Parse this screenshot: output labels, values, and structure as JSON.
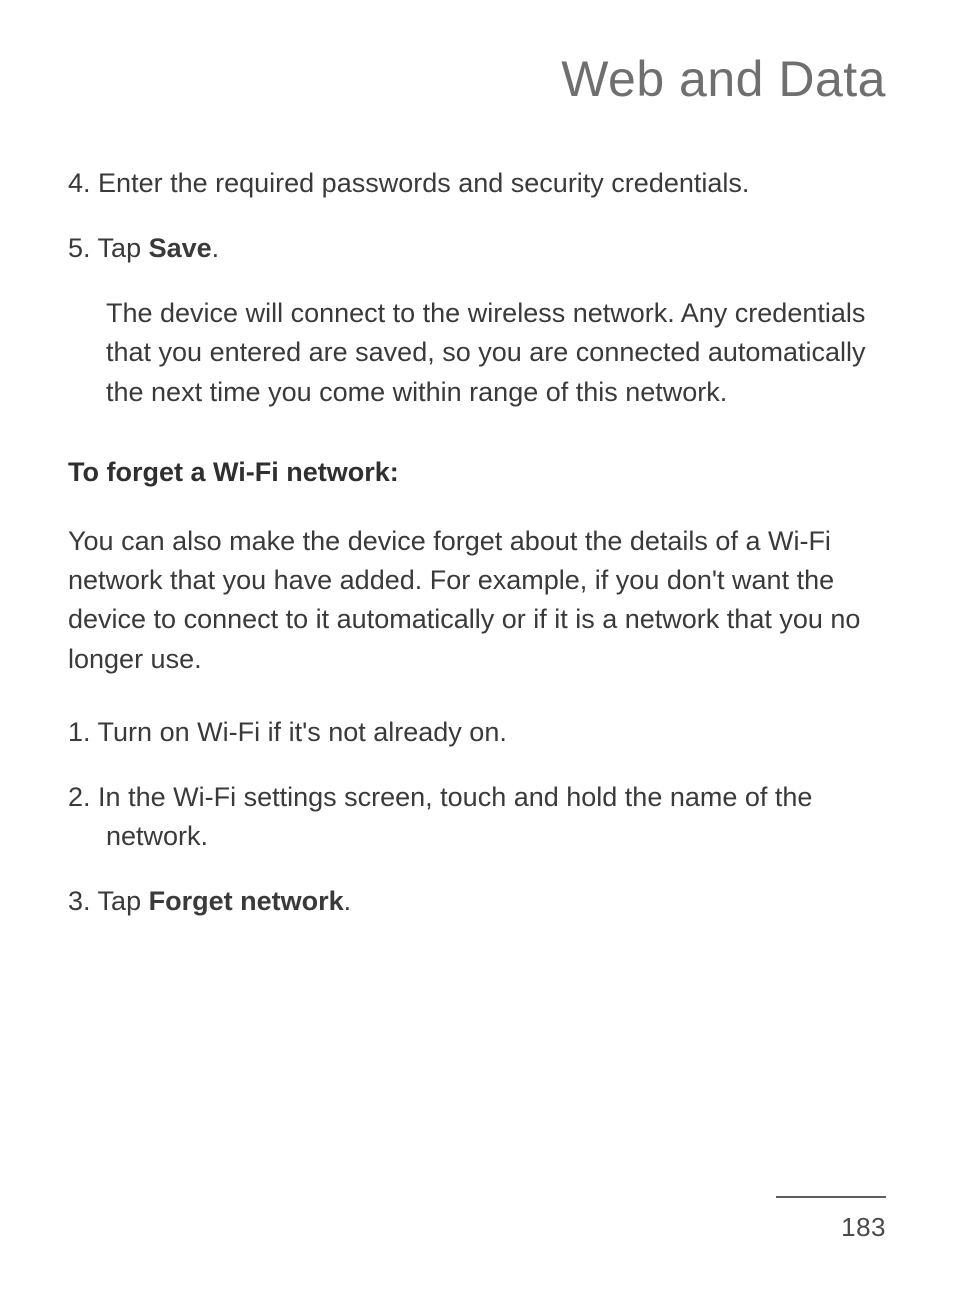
{
  "chapter_title": "Web and Data",
  "steps_a": [
    {
      "num": "4.",
      "text": "Enter the required passwords and security credentials."
    },
    {
      "num": "5.",
      "prefix": "Tap ",
      "bold": "Save",
      "suffix": "."
    }
  ],
  "step5_body": "The device will connect to the wireless network. Any credentials that you entered are saved, so you are connected automatically the next time you come within range of this network.",
  "section_head": "To forget a Wi-Fi network:",
  "section_para": "You can also make the device forget about the details of a Wi-Fi network that you have added. For example, if you don't want the device to connect to it automatically or if it is a network that you no longer use.",
  "steps_b": [
    {
      "num": "1.",
      "text": "Turn on Wi-Fi if it's not already on."
    },
    {
      "num": "2.",
      "text": "In the Wi-Fi settings screen, touch and hold the name of the network."
    },
    {
      "num": "3.",
      "prefix": "Tap ",
      "bold": "Forget network",
      "suffix": "."
    }
  ],
  "page_number": "183"
}
